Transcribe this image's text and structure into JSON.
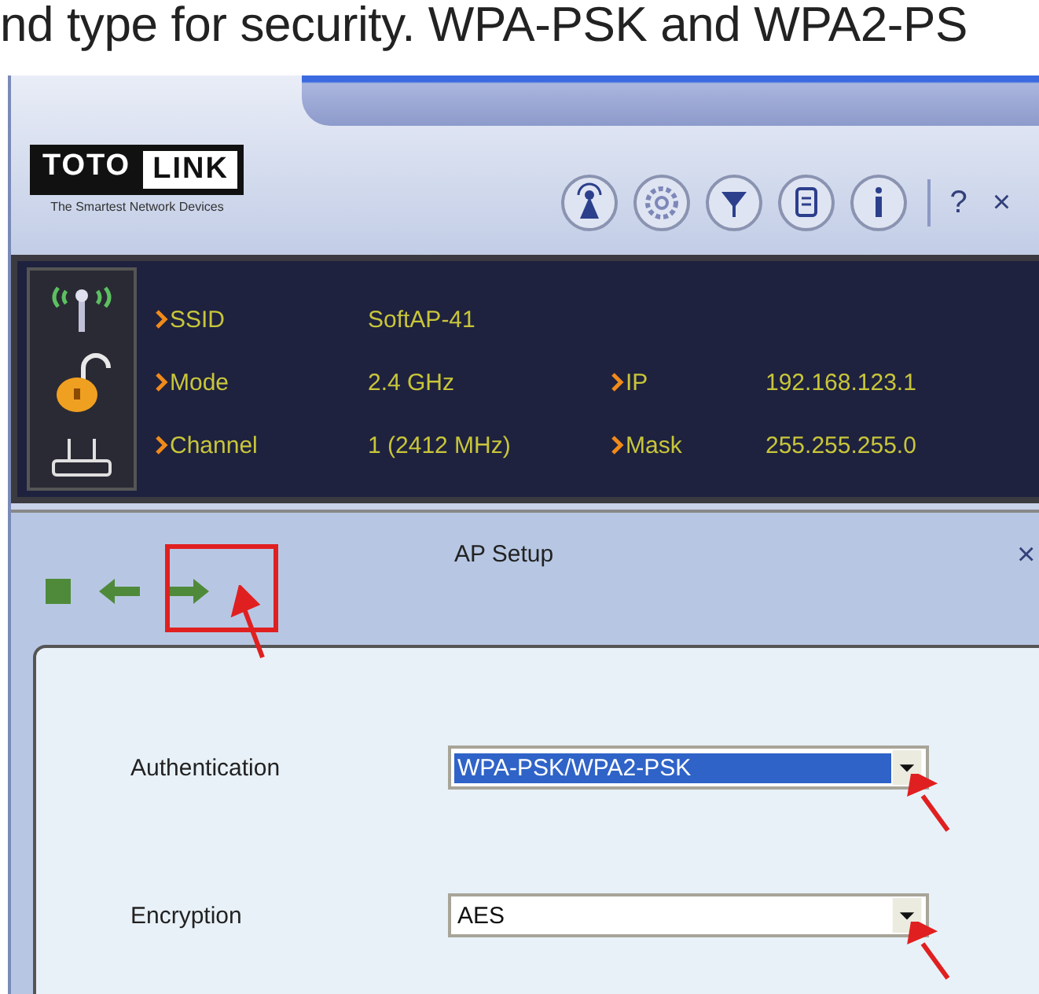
{
  "document_text": "nd type for security. WPA-PSK and WPA2-PS",
  "app": {
    "logo": {
      "part_1": "TOTO",
      "part_2": "LINK",
      "tagline": "The Smartest Network Devices"
    },
    "toolbar": {
      "help": "?",
      "close": "×"
    },
    "info_rows": [
      [
        {
          "label": "SSID",
          "value": "SoftAP-41"
        }
      ],
      [
        {
          "label": "Mode",
          "value": "2.4 GHz"
        },
        {
          "label": "IP",
          "value": "192.168.123.1"
        }
      ],
      [
        {
          "label": "Channel",
          "value": "1 (2412 MHz)"
        },
        {
          "label": "Mask",
          "value": "255.255.255.0"
        }
      ]
    ]
  },
  "ap_setup": {
    "title": "AP Setup",
    "close": "×",
    "fields": [
      {
        "label": "Authentication",
        "value": "WPA-PSK/WPA2-PSK",
        "selected": true
      },
      {
        "label": "Encryption",
        "value": "AES",
        "selected": false
      }
    ]
  }
}
